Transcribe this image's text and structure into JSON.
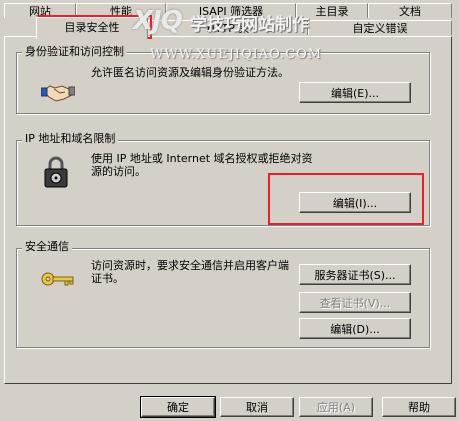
{
  "tabs_row1": [
    "网站",
    "性能",
    "ISAPI 筛选器",
    "主目录",
    "文档"
  ],
  "tabs_row2": [
    "目录安全性",
    "HTTP 头",
    "自定义错误"
  ],
  "auth": {
    "title": "身份验证和访问控制",
    "description": "允许匿名访问资源及编辑身份验证方法。",
    "button": "编辑(E)..."
  },
  "ip": {
    "title": "IP 地址和域名限制",
    "description": "使用 IP 地址或 Internet 域名授权或拒绝对资源的访问。",
    "button": "编辑(I)..."
  },
  "secure": {
    "title": "安全通信",
    "description": "访问资源时，要求安全通信并启用客户端证书。",
    "buttons": {
      "server_cert": "服务器证书(S)...",
      "view_cert": "查看证书(V)...",
      "edit": "编辑(D)..."
    }
  },
  "footer": {
    "ok": "确定",
    "cancel": "取消",
    "apply": "应用(A)",
    "help": "帮助"
  },
  "watermark": {
    "logo": "XJQ",
    "text": "学技巧网站制作",
    "url": "WWW.XUEJIQIAO.COM"
  },
  "colors": {
    "face": "#d4d0c8",
    "highlight": "#e8202a"
  }
}
